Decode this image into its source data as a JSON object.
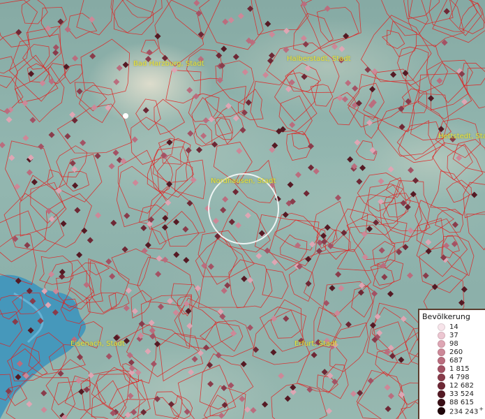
{
  "map": {
    "region_labels": [
      {
        "id": "bad-harzburg",
        "text": "Bad Harzburg, Stadt"
      },
      {
        "id": "halberstadt",
        "text": "Halberstadt, Stadt"
      },
      {
        "id": "hettstedt",
        "text": "Hettstedt, Stadt"
      },
      {
        "id": "nordhausen",
        "text": "Nordhausen, Stadt"
      },
      {
        "id": "eisenach",
        "text": "Eisenach, Stadt"
      },
      {
        "id": "erfurt",
        "text": "Erfurt, Stadt"
      }
    ],
    "colors": {
      "boundary": "#e02020",
      "water": "#2e8fc0",
      "terrain": "#8fb3ad",
      "selection_ring": "#ffffff"
    }
  },
  "legend": {
    "title": "Bevölkerung",
    "entries": [
      {
        "label": "14",
        "color": "#f7e4ea"
      },
      {
        "label": "37",
        "color": "#ecc6d1"
      },
      {
        "label": "98",
        "color": "#dea6b4"
      },
      {
        "label": "260",
        "color": "#cd8898"
      },
      {
        "label": "687",
        "color": "#ba6d7e"
      },
      {
        "label": "1 815",
        "color": "#a35264"
      },
      {
        "label": "4 798",
        "color": "#893c4b"
      },
      {
        "label": "12 682",
        "color": "#6e2835"
      },
      {
        "label": "33 524",
        "color": "#551a24"
      },
      {
        "label": "88 615",
        "color": "#3a0f16"
      },
      {
        "label": "234 243",
        "color": "#1f060a",
        "suffix": "+"
      }
    ]
  }
}
